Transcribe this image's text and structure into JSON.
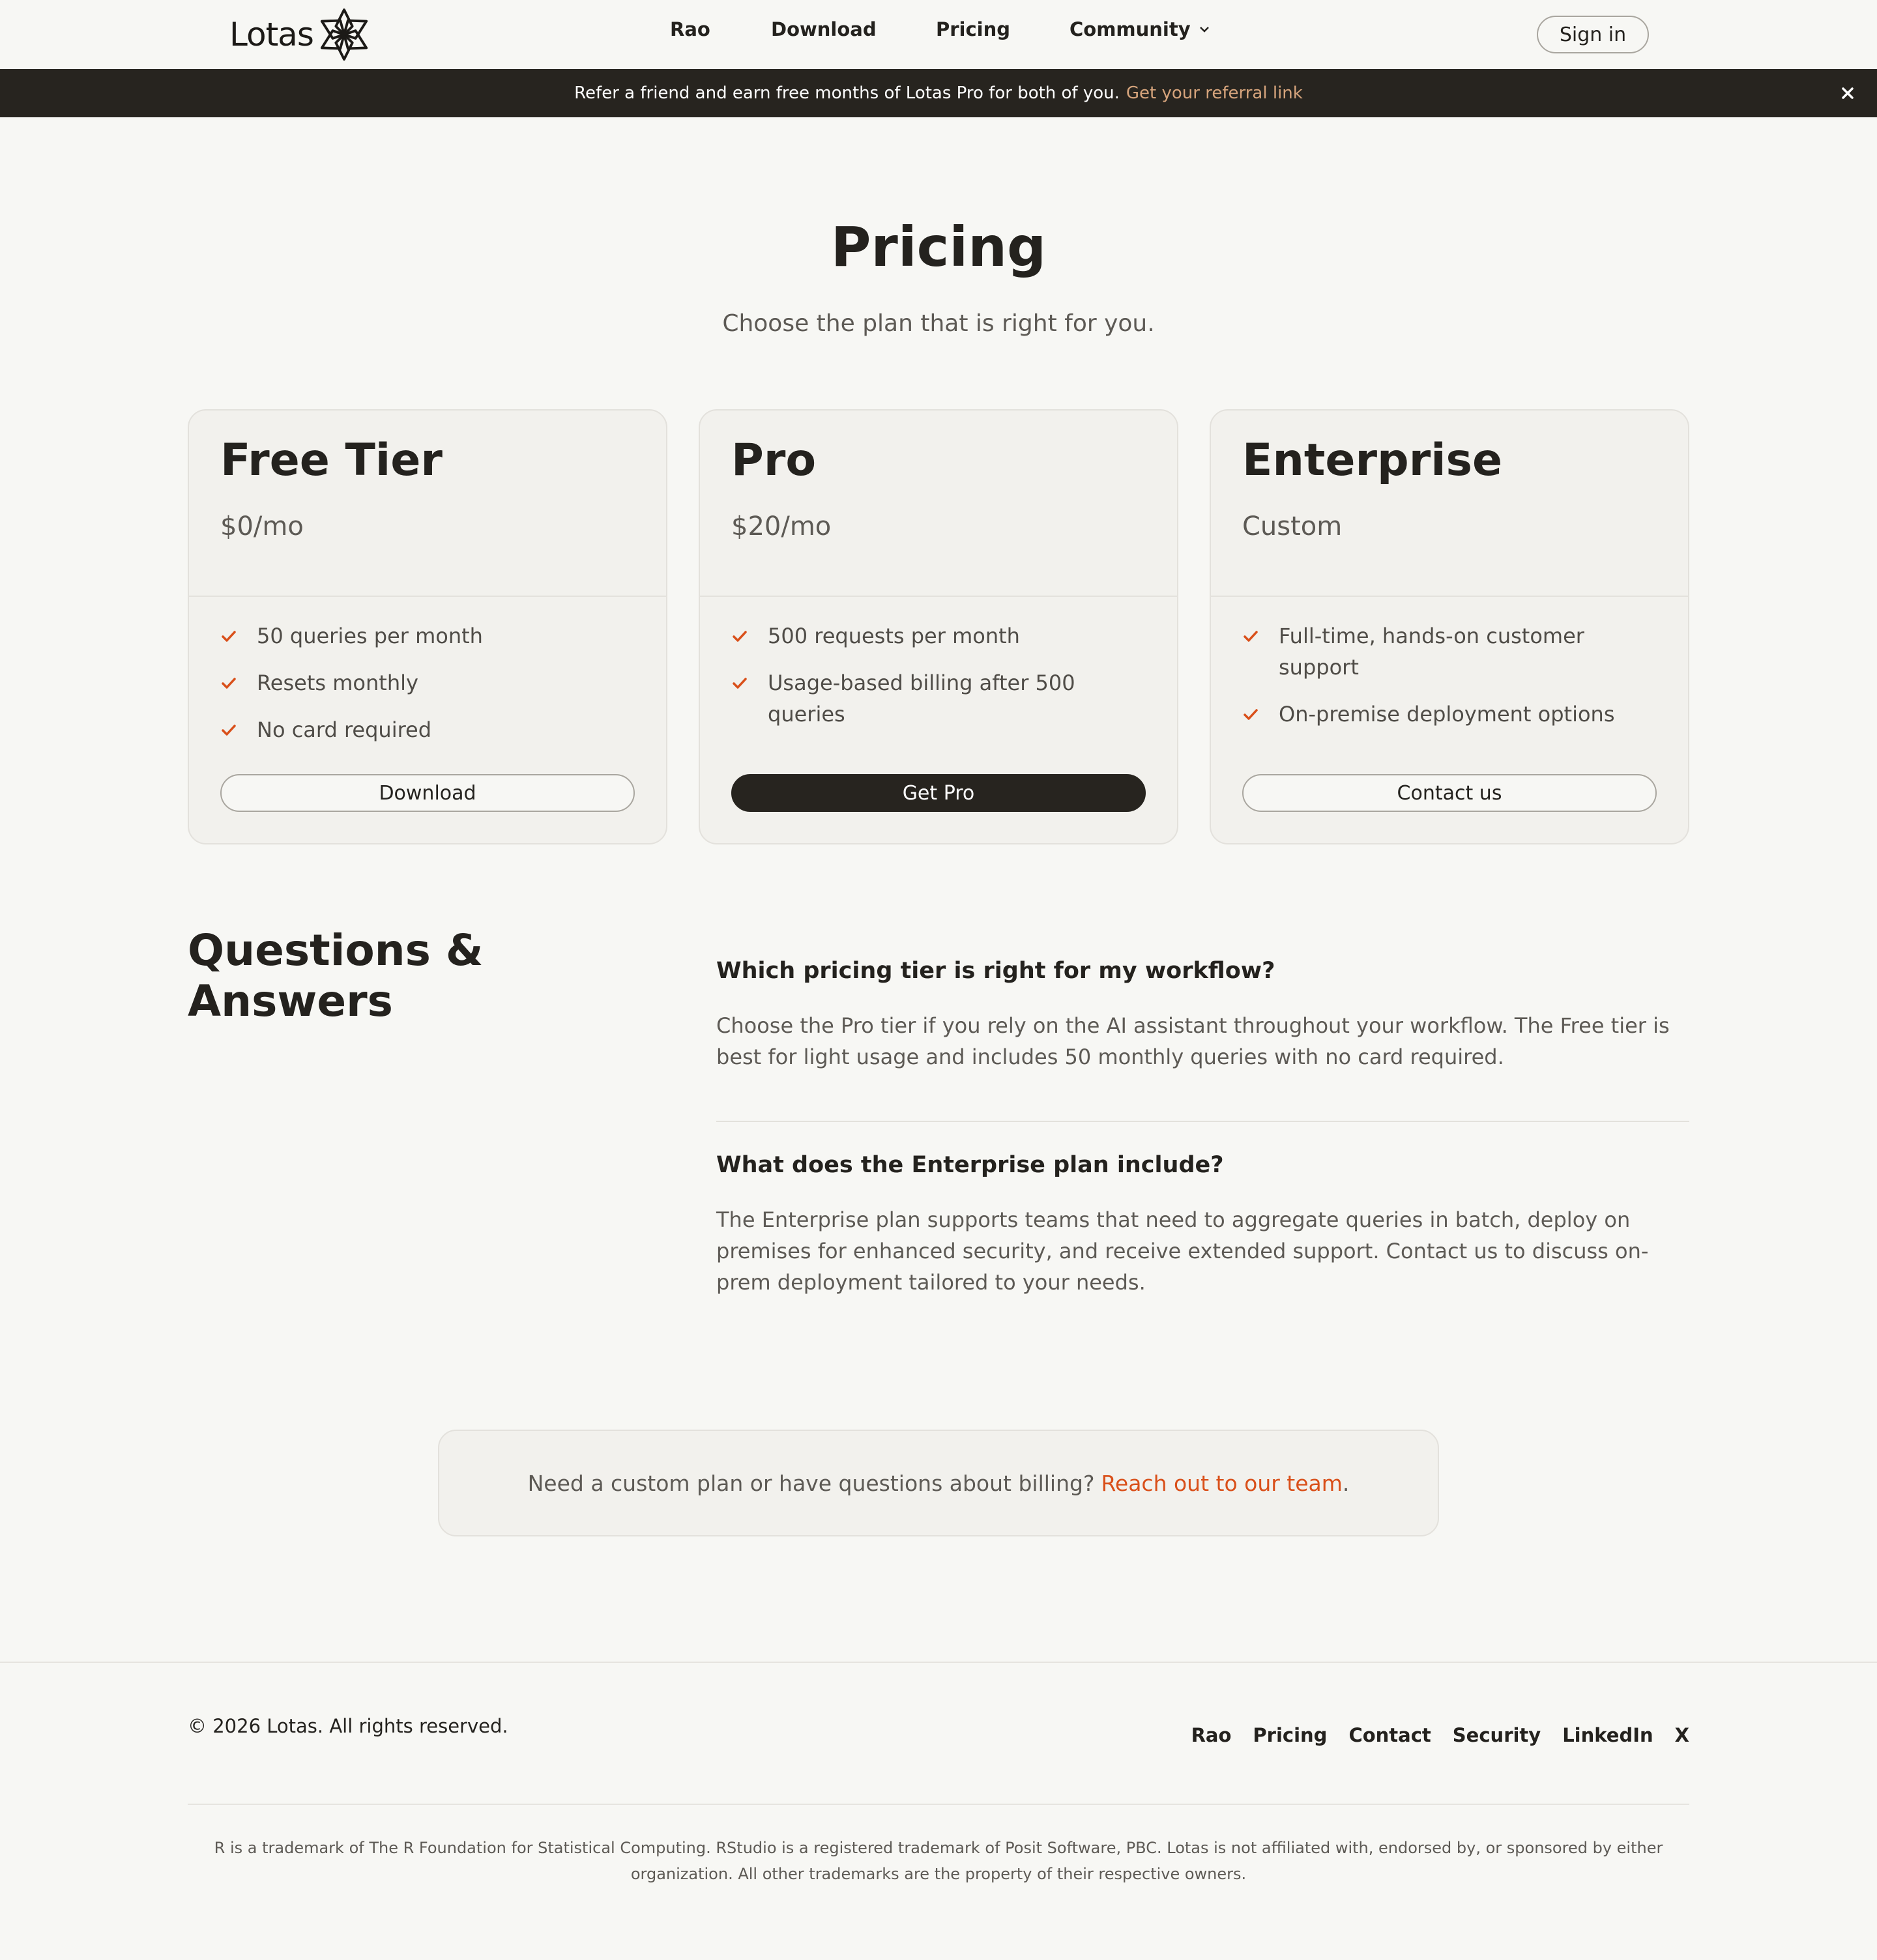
{
  "nav": {
    "logo_text": "Lotas",
    "links": [
      "Rao",
      "Download",
      "Pricing",
      "Community"
    ],
    "signin_label": "Sign in"
  },
  "banner": {
    "text": "Refer a friend and earn free months of Lotas Pro for both of you.",
    "link_text": "Get your referral link",
    "close_icon": "close-icon"
  },
  "hero": {
    "title": "Pricing",
    "subtitle": "Choose the plan that is right for you."
  },
  "plans": [
    {
      "name": "Free Tier",
      "price": "$0/mo",
      "features": [
        "50 queries per month",
        "Resets monthly",
        "No card required"
      ],
      "button_label": "Download"
    },
    {
      "name": "Pro",
      "price": "$20/mo",
      "features": [
        "500 requests per month",
        "Usage-based billing after 500 queries"
      ],
      "button_label": "Get Pro"
    },
    {
      "name": "Enterprise",
      "price": "Custom",
      "features": [
        "Full-time, hands-on customer support",
        "On-premise deployment options"
      ],
      "button_label": "Contact us"
    }
  ],
  "faq": {
    "title": "Questions & Answers",
    "items": [
      {
        "question": "Which pricing tier is right for my workflow?",
        "answer": "Choose the Pro tier if you rely on the AI assistant throughout your workflow. The Free tier is best for light usage and includes 50 monthly queries with no card required."
      },
      {
        "question": "What does the Enterprise plan include?",
        "answer": "The Enterprise plan supports teams that need to aggregate queries in batch, deploy on premises for enhanced security, and receive extended support. Contact us to discuss on-prem deployment tailored to your needs."
      }
    ]
  },
  "cta": {
    "text": "Need a custom plan or have questions about billing?",
    "link_text": "Reach out to our team",
    "suffix": "."
  },
  "footer": {
    "copyright": "© 2026 Lotas. All rights reserved.",
    "links": [
      "Rao",
      "Pricing",
      "Contact",
      "Security",
      "LinkedIn",
      "X"
    ],
    "legal": "R is a trademark of The R Foundation for Statistical Computing. RStudio is a registered trademark of Posit Software, PBC. Lotas is not affiliated with, endorsed by, or sponsored by either organization. All other trademarks are the property of their respective owners."
  },
  "colors": {
    "background": "#f7f7f4",
    "card": "#f2f1ed",
    "dark": "#27241f",
    "accent": "#d94f19",
    "banner_link": "#d6a47c"
  }
}
